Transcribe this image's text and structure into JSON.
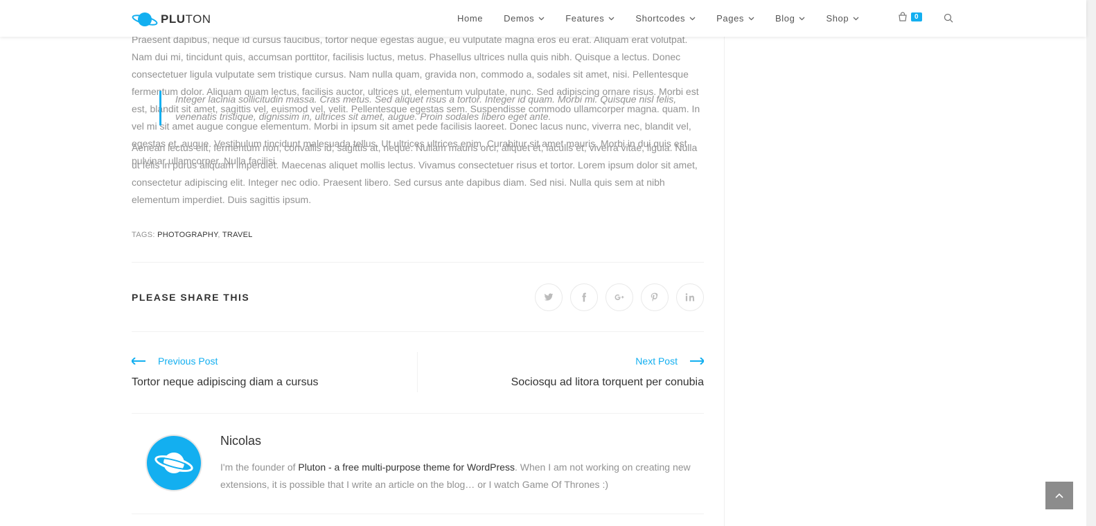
{
  "header": {
    "logo": {
      "bold": "PLU",
      "rest": "TON"
    },
    "menu": [
      {
        "label": "Home",
        "has_dropdown": false
      },
      {
        "label": "Demos",
        "has_dropdown": true
      },
      {
        "label": "Features",
        "has_dropdown": true
      },
      {
        "label": "Shortcodes",
        "has_dropdown": true
      },
      {
        "label": "Pages",
        "has_dropdown": true
      },
      {
        "label": "Blog",
        "has_dropdown": true
      },
      {
        "label": "Shop",
        "has_dropdown": true
      }
    ],
    "cart_count": "0",
    "icons": {
      "cart": "shopping-bag-icon",
      "search": "search-icon"
    }
  },
  "article": {
    "partial_paragraph": "Vivamus luctus cursus risus vitae pharetra. Sed sit amet mauris quis lectus condimentum. Curabitur ultrices posuere cubilia Curae; Morbi in sem quis dui placerat ornare. Pellentesque odio nisi, euismod in, pharetra a, ultricies in, diam. Sed arcu. Cras consequat. Praesent dapibus, neque id cursus faucibus, tortor neque egestas augue, eu vulputate magna eros eu erat. Aliquam erat volutpat. Nam dui mi, tincidunt quis, accumsan porttitor, facilisis luctus, metus. Phasellus ultrices nulla quis nibh. Quisque a lectus. Donec consectetuer ligula vulputate sem tristique cursus. Nam nulla quam, gravida non, commodo a, sodales sit amet, nisi. Pellentesque fermentum dolor. Aliquam quam lectus, facilisis auctor, ultrices ut, elementum vulputate, nunc. Sed adipiscing ornare risus. Morbi est est, blandit sit amet, sagittis vel, euismod vel, velit. Pellentesque egestas sem. Suspendisse commodo ullamcorper magna. quam. In vel mi sit amet augue congue elementum. Morbi in ipsum sit amet pede facilisis laoreet. Donec lacus nunc, viverra nec, blandit vel, egestas et, augue. Vestibulum tincidunt malesuada tellus. Ut ultrices ultrices enim. Curabitur sit amet mauris. Morbi in dui quis est pulvinar ullamcorper. Nulla facilisi.",
    "blockquote": "Integer lacinia sollicitudin massa. Cras metus. Sed aliquet risus a tortor. Integer id quam. Morbi mi. Quisque nisl felis, venenatis tristique, dignissim in, ultrices sit amet, augue. Proin sodales libero eget ante.",
    "paragraph": "Aenean lectus elit, fermentum non, convallis id, sagittis at, neque. Nullam mauris orci, aliquet et, iaculis et, viverra vitae, ligula. Nulla ut felis in purus aliquam imperdiet. Maecenas aliquet mollis lectus. Vivamus consectetuer risus et tortor. Lorem ipsum dolor sit amet, consectetur adipiscing elit. Integer nec odio. Praesent libero. Sed cursus ante dapibus diam. Sed nisi. Nulla quis sem at nibh elementum imperdiet. Duis sagittis ipsum.",
    "tags_label": "TAGS:",
    "tags": [
      "PHOTOGRAPHY",
      "TRAVEL"
    ],
    "tag_separator": ","
  },
  "share": {
    "title": "PLEASE SHARE THIS",
    "buttons": [
      "twitter-icon",
      "facebook-icon",
      "google-plus-icon",
      "pinterest-icon",
      "linkedin-icon"
    ]
  },
  "post_nav": {
    "prev_label": "Previous Post",
    "prev_title": "Tortor neque adipiscing diam a cursus",
    "next_label": "Next Post",
    "next_title": "Sociosqu ad litora torquent per conubia"
  },
  "author": {
    "name": "Nicolas",
    "bio_before": "I'm the founder of ",
    "bio_link": "Pluton - a free multi-purpose theme for WordPress",
    "bio_after": ". When I am not working on creating new extensions, it is possible that I write an article on the blog… or I watch Game Of Thrones :)"
  },
  "colors": {
    "accent": "#13aff0",
    "text": "#929292",
    "heading": "#333333"
  }
}
